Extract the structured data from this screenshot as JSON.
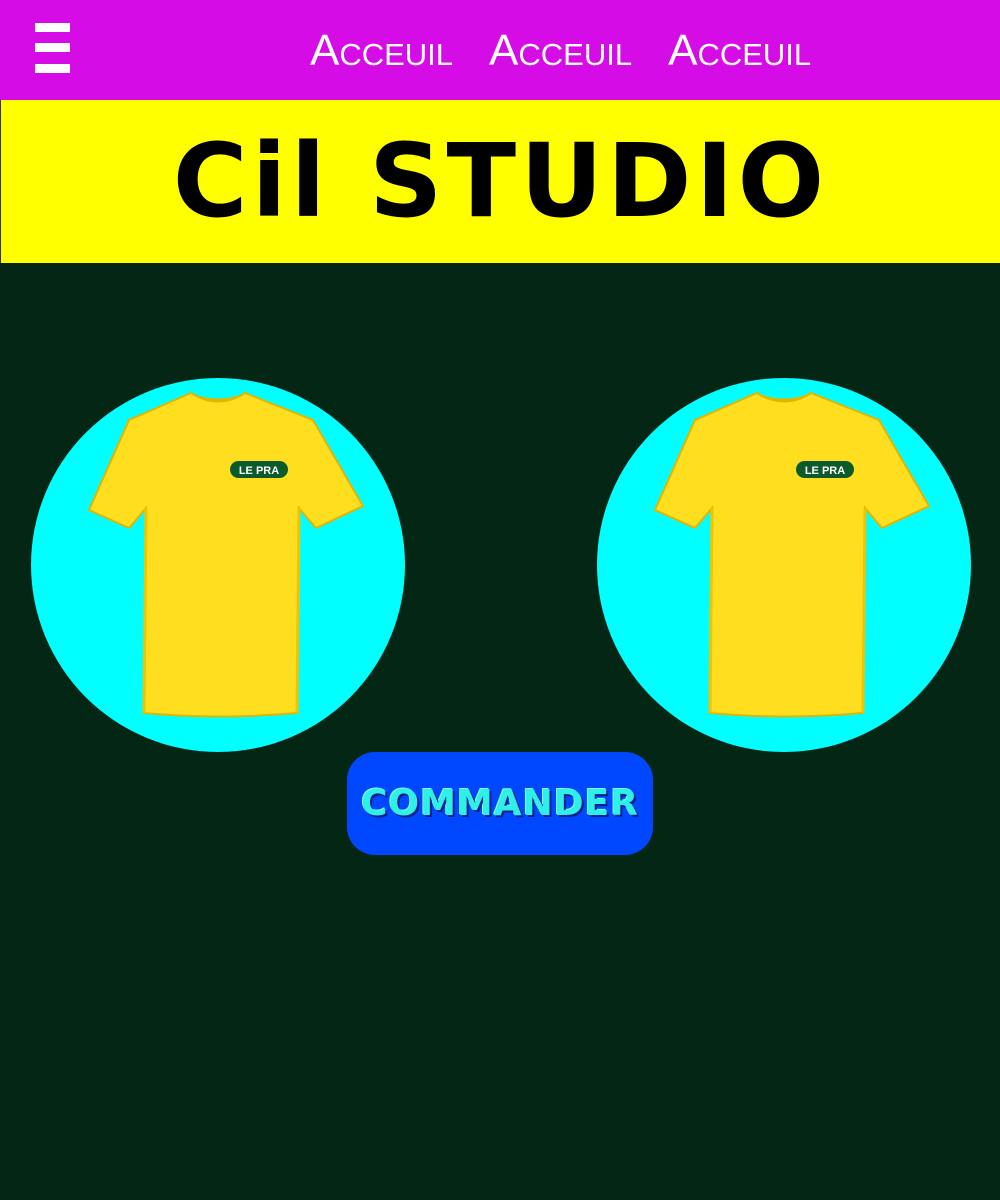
{
  "header": {
    "menu_icon": "hamburger-menu-icon",
    "nav_items": [
      {
        "label": "Acceuil"
      },
      {
        "label": "Acceuil"
      },
      {
        "label": "Acceuil"
      }
    ]
  },
  "banner": {
    "title": "Cil STUDIO"
  },
  "products": [
    {
      "image": "yellow-tshirt-image",
      "logo_text": "LE PRA"
    },
    {
      "image": "yellow-tshirt-image",
      "logo_text": "LE PRA"
    }
  ],
  "order_button": {
    "label": "COMMANDER"
  },
  "colors": {
    "nav_bar": "#d60ce6",
    "banner": "#ffff00",
    "page_background": "#042614",
    "product_circle": "#00ffff",
    "tshirt": "#ffdd1f",
    "button": "#0048ff",
    "button_text": "#2ef0e6"
  }
}
